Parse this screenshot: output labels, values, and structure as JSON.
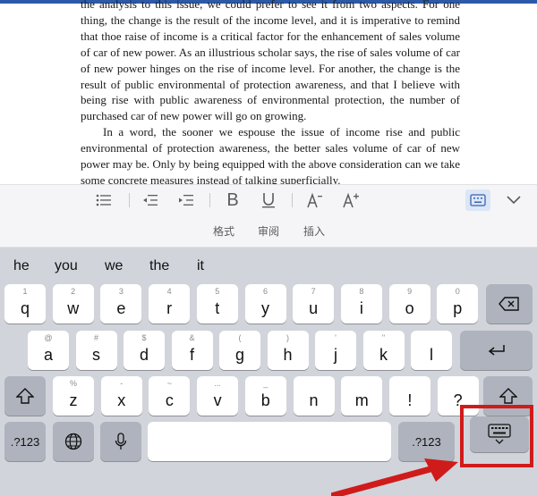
{
  "document": {
    "paragraphs": [
      {
        "indent": false,
        "text": "the analysis to this issue, we could prefer to see it from two aspects. For one thing, the change is the result of the income level, and it is imperative to remind that thoe raise of income is a critical factor for the enhancement of sales volume of car of new power. As an illustrious scholar says, the rise of sales volume of car of new power hinges on the rise of income level. For another, the change is the result of public environmental of protection awareness, and that I believe with being rise with public awareness of environmental protection, the number of purchased car of new power will go on growing."
      },
      {
        "indent": true,
        "text": "In a word, the sooner we espouse the issue of income rise and public environmental of protection awareness, the better sales volume of car of new power may be. Only by being equipped with the above consideration can we take some concrete measures instead of talking superficially."
      }
    ]
  },
  "toolbar": {
    "buttons": [
      "list-icon",
      "outdent-icon",
      "indent-icon",
      "bold-icon",
      "underline-icon",
      "decrease-font-icon",
      "increase-font-icon",
      "keyboard-toggle-icon",
      "chevron-down-icon"
    ]
  },
  "tabs": [
    "格式",
    "审阅",
    "插入"
  ],
  "keyboard": {
    "suggestions": [
      "he",
      "you",
      "we",
      "the",
      "it"
    ],
    "row1": [
      {
        "hint": "1",
        "key": "q"
      },
      {
        "hint": "2",
        "key": "w"
      },
      {
        "hint": "3",
        "key": "e"
      },
      {
        "hint": "4",
        "key": "r"
      },
      {
        "hint": "5",
        "key": "t"
      },
      {
        "hint": "6",
        "key": "y"
      },
      {
        "hint": "7",
        "key": "u"
      },
      {
        "hint": "8",
        "key": "i"
      },
      {
        "hint": "9",
        "key": "o"
      },
      {
        "hint": "0",
        "key": "p"
      }
    ],
    "row2": [
      {
        "hint": "@",
        "key": "a"
      },
      {
        "hint": "#",
        "key": "s"
      },
      {
        "hint": "$",
        "key": "d"
      },
      {
        "hint": "&",
        "key": "f"
      },
      {
        "hint": "(",
        "key": "g"
      },
      {
        "hint": ")",
        "key": "h"
      },
      {
        "hint": "'",
        "key": "j"
      },
      {
        "hint": "\"",
        "key": "k"
      },
      {
        "hint": "",
        "key": "l"
      }
    ],
    "row3": [
      {
        "hint": "%",
        "key": "z"
      },
      {
        "hint": "-",
        "key": "x"
      },
      {
        "hint": "~",
        "key": "c"
      },
      {
        "hint": "...",
        "key": "v"
      },
      {
        "hint": "_",
        "key": "b"
      },
      {
        "hint": "",
        "key": "n"
      },
      {
        "hint": "",
        "key": "m"
      },
      {
        "hint": "",
        "key": "!"
      },
      {
        "hint": "",
        "key": "?"
      }
    ],
    "numbers_label": ".?123",
    "numbers_label_right": ".?123"
  }
}
